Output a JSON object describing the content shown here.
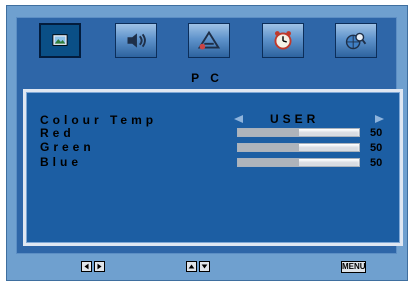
{
  "tabs": [
    {
      "name": "picture",
      "icon": "picture-icon",
      "active": true
    },
    {
      "name": "sound",
      "icon": "speaker-icon",
      "active": false
    },
    {
      "name": "setup",
      "icon": "setup-icon",
      "active": false
    },
    {
      "name": "time",
      "icon": "clock-icon",
      "active": false
    },
    {
      "name": "options",
      "icon": "globe-magnifier-icon",
      "active": false
    }
  ],
  "page_title": "P C",
  "settings": {
    "colour_temp": {
      "label": "Colour Temp",
      "value": "USER"
    },
    "red": {
      "label": "Red",
      "value": "50",
      "level": 0.5
    },
    "green": {
      "label": "Green",
      "value": "50",
      "level": 0.5
    },
    "blue": {
      "label": "Blue",
      "value": "50",
      "level": 0.5
    }
  },
  "footer": {
    "left_right_hint": "left-right-arrow-keys",
    "up_down_hint": "up-down-arrow-keys",
    "menu_key": "MENU"
  },
  "colors": {
    "frame": "#6fa0cf",
    "panel": "#1c5ea3",
    "active_tab": "#0a4f86"
  }
}
